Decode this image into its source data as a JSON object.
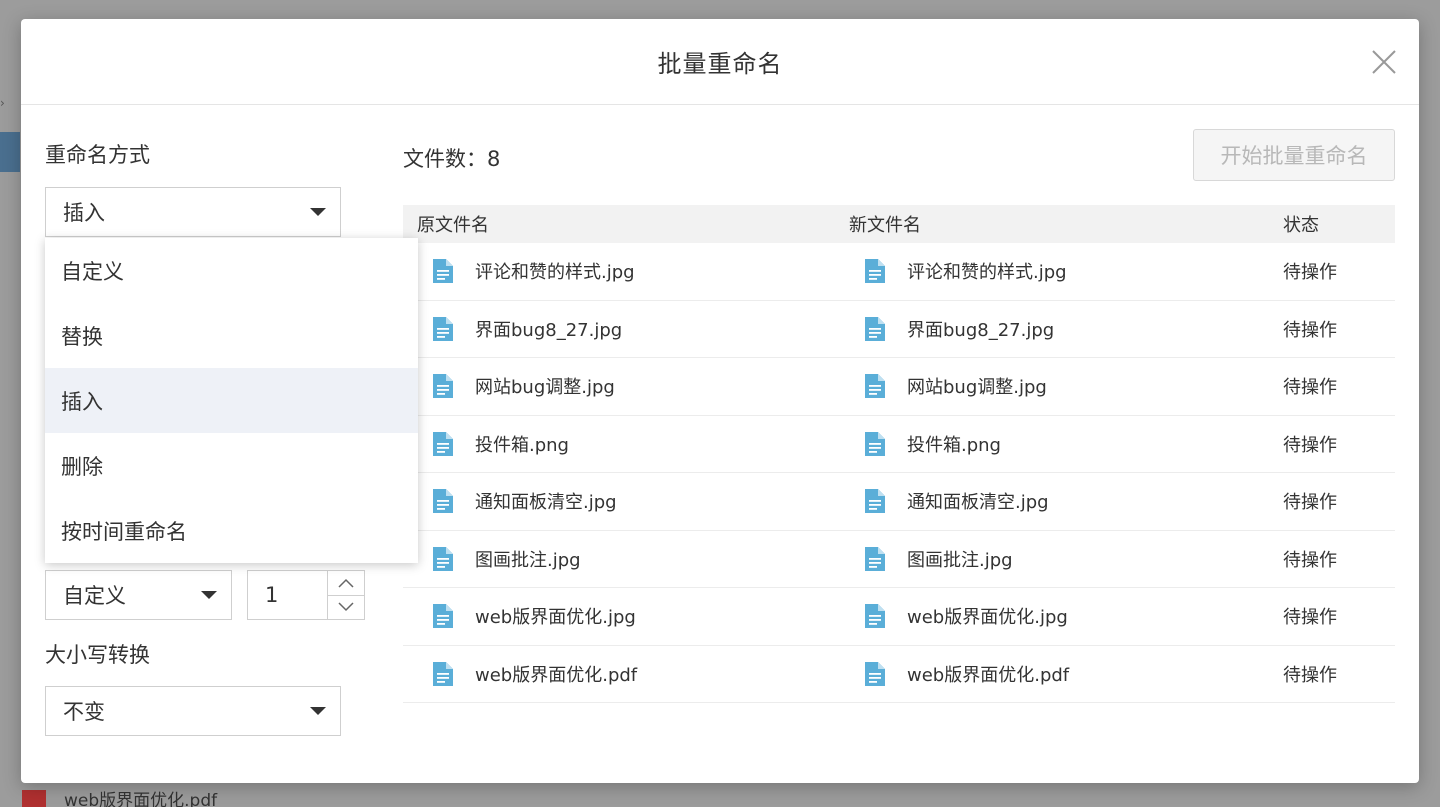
{
  "background": {
    "bottom_file_name": "web版界面优化.pdf"
  },
  "modal": {
    "title": "批量重命名",
    "close_icon": "close-icon"
  },
  "left_panel": {
    "method_label": "重命名方式",
    "method_selected": "插入",
    "method_options": [
      "自定义",
      "替换",
      "插入",
      "删除",
      "按时间重命名"
    ],
    "position_selected": "自定义",
    "position_value": "1",
    "case_label": "大小写转换",
    "case_selected": "不变"
  },
  "right_panel": {
    "file_count_label": "文件数：",
    "file_count": "8",
    "start_button": "开始批量重命名",
    "columns": [
      "原文件名",
      "新文件名",
      "状态"
    ],
    "rows": [
      {
        "old": "评论和赞的样式.jpg",
        "new": "评论和赞的样式.jpg",
        "status": "待操作"
      },
      {
        "old": "界面bug8_27.jpg",
        "new": "界面bug8_27.jpg",
        "status": "待操作"
      },
      {
        "old": "网站bug调整.jpg",
        "new": "网站bug调整.jpg",
        "status": "待操作"
      },
      {
        "old": "投件箱.png",
        "new": "投件箱.png",
        "status": "待操作"
      },
      {
        "old": "通知面板清空.jpg",
        "new": "通知面板清空.jpg",
        "status": "待操作"
      },
      {
        "old": "图画批注.jpg",
        "new": "图画批注.jpg",
        "status": "待操作"
      },
      {
        "old": "web版界面优化.jpg",
        "new": "web版界面优化.jpg",
        "status": "待操作"
      },
      {
        "old": "web版界面优化.pdf",
        "new": "web版界面优化.pdf",
        "status": "待操作"
      }
    ]
  },
  "colors": {
    "file_icon": "#5aaed8",
    "dropdown_active": "#eef1f7",
    "header_bg": "#f2f2f2"
  }
}
